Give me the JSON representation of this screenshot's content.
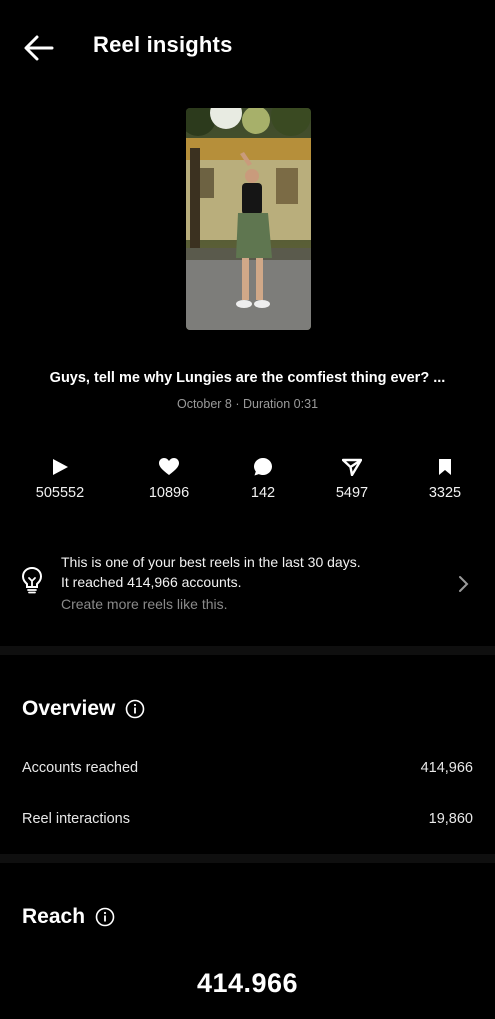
{
  "header": {
    "title": "Reel insights",
    "back_icon": "arrow-left-icon"
  },
  "reel": {
    "caption": "Guys, tell me why Lungies are the comfiest thing ever? ...",
    "meta": "October 8 · Duration 0:31"
  },
  "stats": [
    {
      "icon": "play-icon",
      "value": "505552"
    },
    {
      "icon": "heart-icon",
      "value": "10896"
    },
    {
      "icon": "comment-icon",
      "value": "142"
    },
    {
      "icon": "share-icon",
      "value": "5497"
    },
    {
      "icon": "bookmark-icon",
      "value": "3325"
    }
  ],
  "tip": {
    "line1": "This is one of your best reels in the last 30 days.",
    "line2": "It reached 414,966 accounts.",
    "line3": "Create more reels like this.",
    "icon": "lightbulb-icon"
  },
  "overview": {
    "title": "Overview",
    "rows": [
      {
        "label": "Accounts reached",
        "value": "414,966"
      },
      {
        "label": "Reel interactions",
        "value": "19,860"
      }
    ]
  },
  "reach": {
    "title": "Reach",
    "value": "414.966"
  },
  "colors": {
    "background": "#000000",
    "text": "#ffffff",
    "muted": "#9a9a9a",
    "divider": "#0f0f0f"
  }
}
